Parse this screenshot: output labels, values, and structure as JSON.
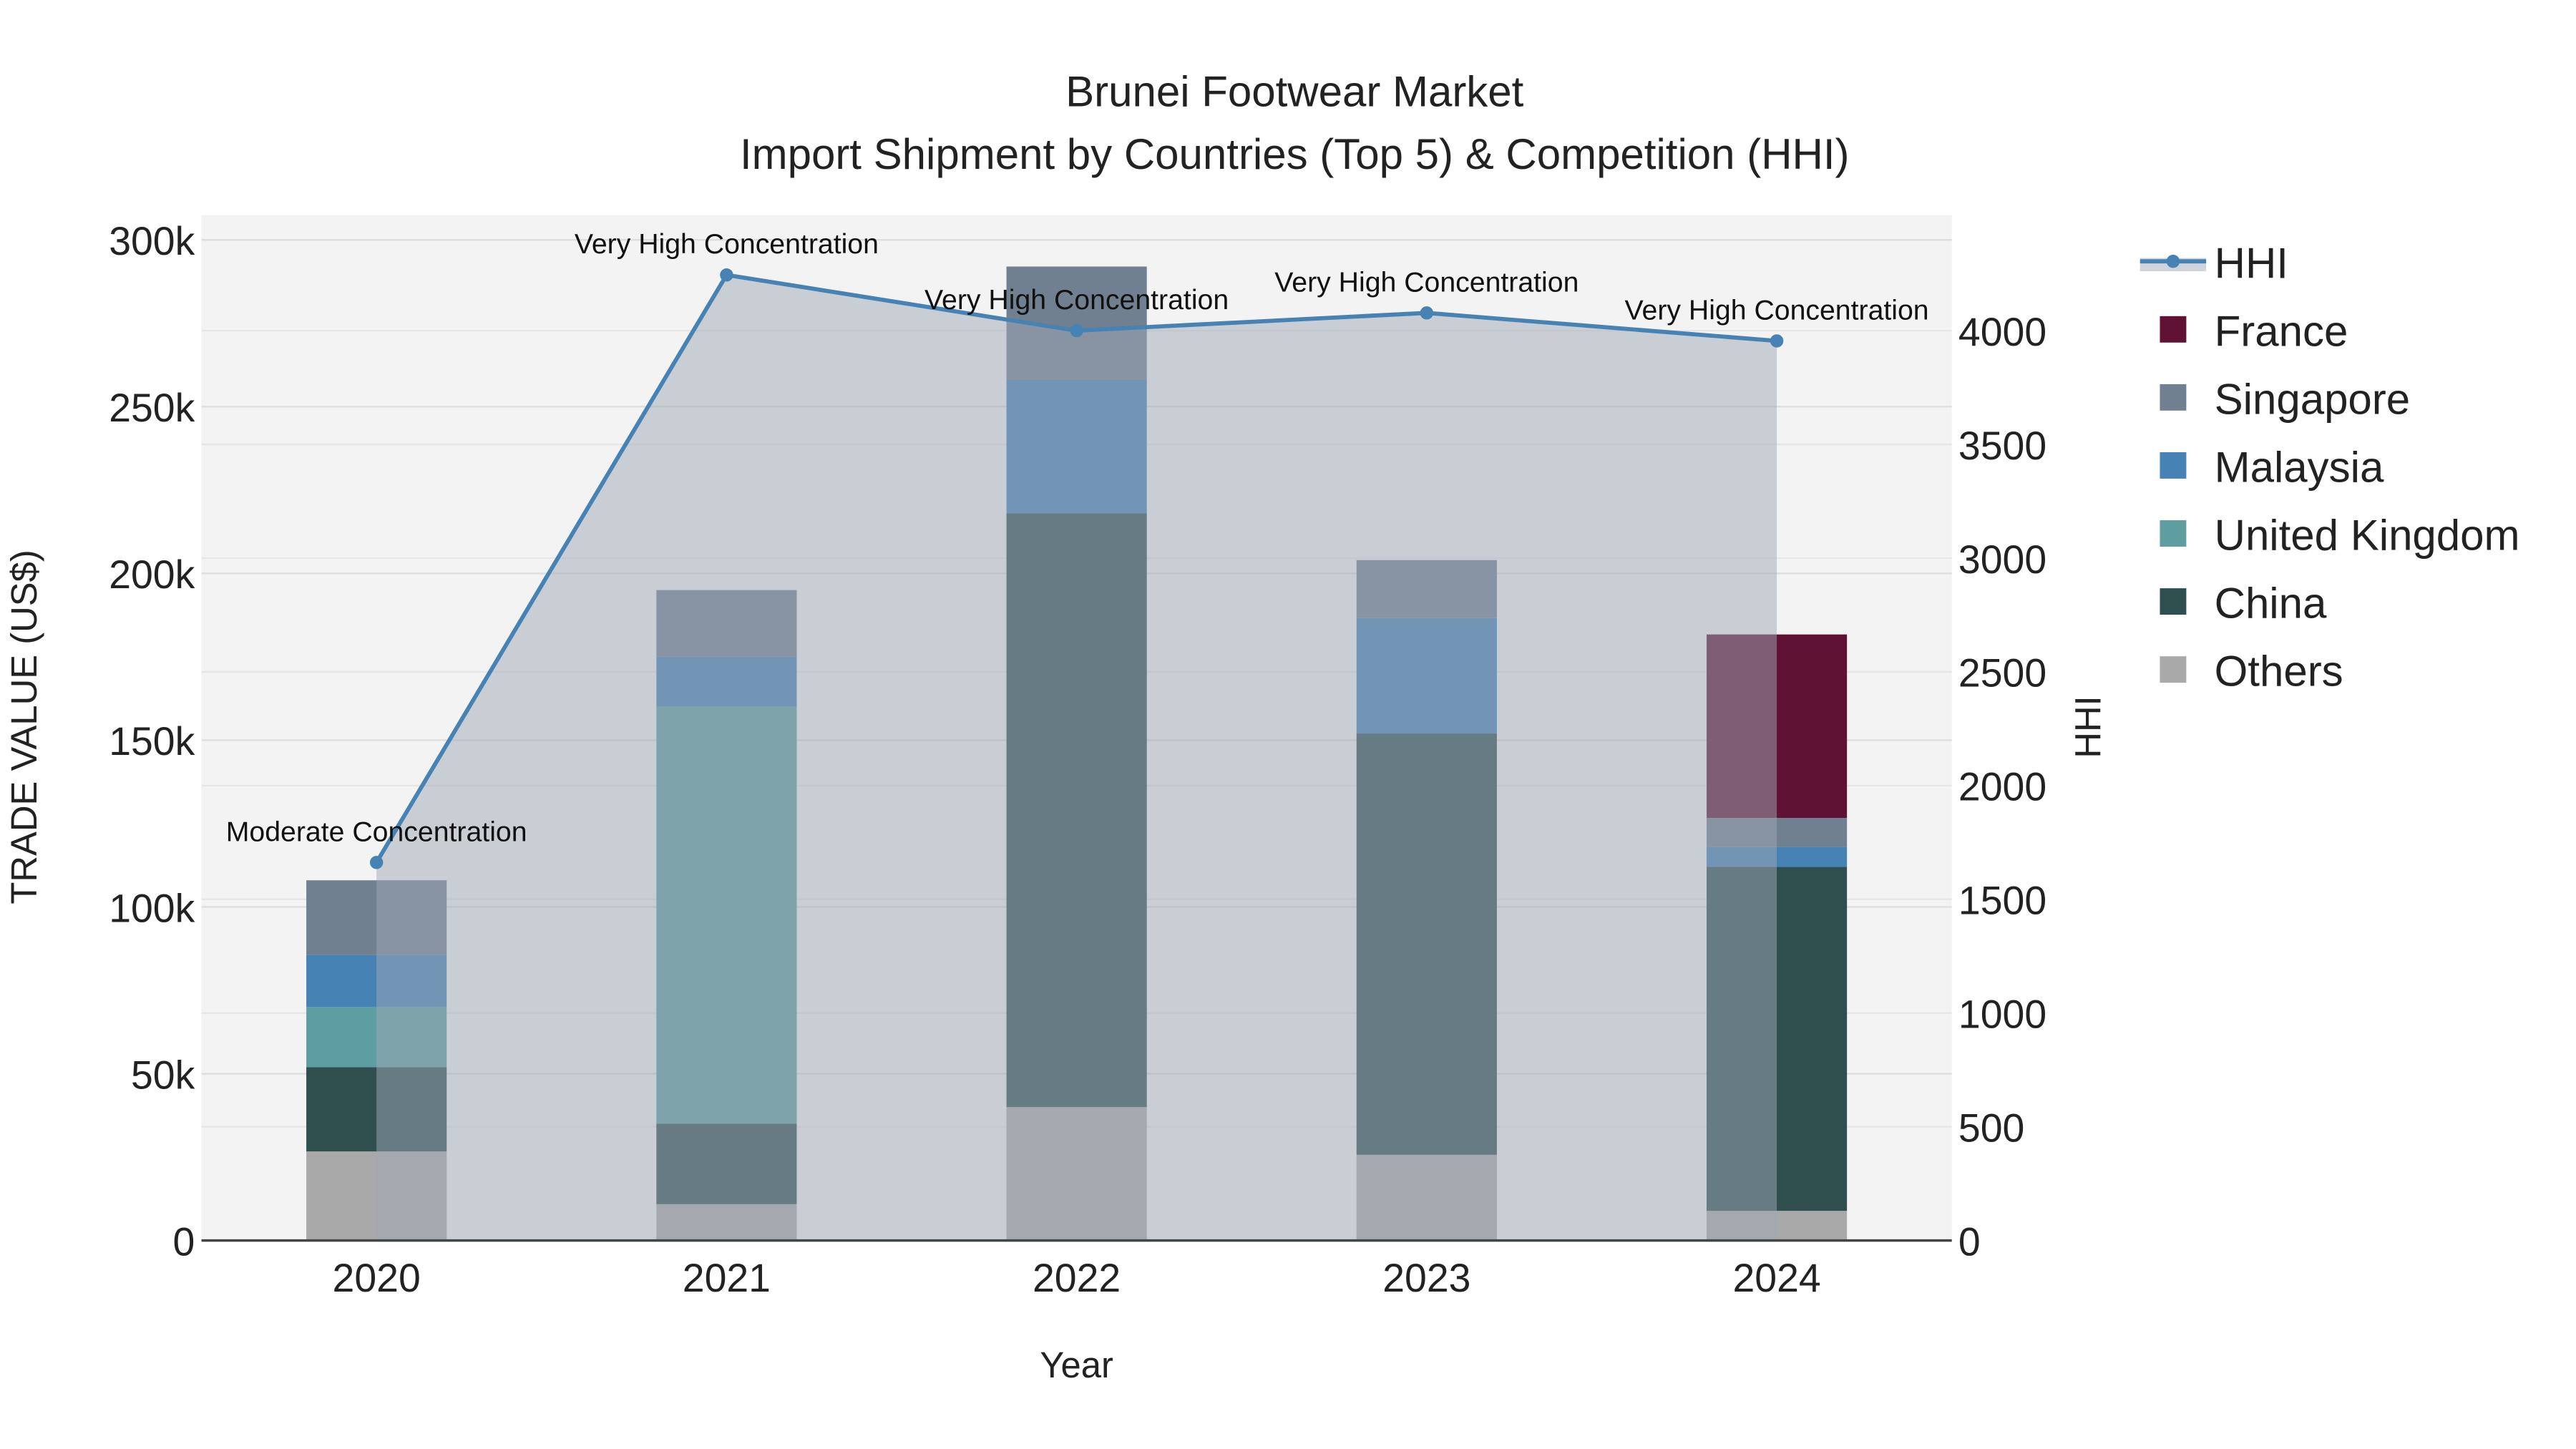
{
  "chart_data": {
    "type": "bar",
    "stacked": true,
    "title": "Brunei Footwear Market",
    "subtitle": "Import Shipment by Countries (Top 5) & Competition (HHI)",
    "xlabel": "Year",
    "ylabel": "TRADE VALUE (US$)",
    "y2label": "HHI",
    "categories": [
      "2020",
      "2021",
      "2022",
      "2023",
      "2024"
    ],
    "ylim": [
      0,
      300000
    ],
    "y2lim": [
      0,
      4400
    ],
    "yticks": [
      0,
      50000,
      100000,
      150000,
      200000,
      250000,
      300000
    ],
    "ytick_labels": [
      "0",
      "50k",
      "100k",
      "150k",
      "200k",
      "250k",
      "300k"
    ],
    "y2ticks": [
      0,
      500,
      1000,
      1500,
      2000,
      2500,
      3000,
      3500,
      4000
    ],
    "y2tick_labels": [
      "0",
      "500",
      "1000",
      "1500",
      "2000",
      "2500",
      "3000",
      "3500",
      "4000"
    ],
    "series": [
      {
        "name": "Others",
        "color": "#a9a9a9",
        "values": [
          26700,
          10900,
          40000,
          25700,
          8900
        ]
      },
      {
        "name": "China",
        "color": "#2f4f4f",
        "values": [
          25300,
          24100,
          178000,
          126300,
          103100
        ]
      },
      {
        "name": "United Kingdom",
        "color": "#5f9ea0",
        "values": [
          18000,
          125000,
          0,
          0,
          0
        ]
      },
      {
        "name": "Malaysia",
        "color": "#4682b4",
        "values": [
          15600,
          15000,
          40000,
          34600,
          6000
        ]
      },
      {
        "name": "Singapore",
        "color": "#708090",
        "values": [
          22400,
          20000,
          34000,
          17400,
          8700
        ]
      },
      {
        "name": "France",
        "color": "#5f1233",
        "values": [
          0,
          0,
          0,
          0,
          55000
        ]
      }
    ],
    "hhi": {
      "name": "HHI",
      "color": "#4682b4",
      "values": [
        1662,
        4245,
        4000,
        4078,
        3955
      ],
      "annotations": [
        "Moderate Concentration",
        "Very High Concentration",
        "Very High Concentration",
        "Very High Concentration",
        "Very High Concentration"
      ]
    },
    "legend": [
      "HHI",
      "France",
      "Singapore",
      "Malaysia",
      "United Kingdom",
      "China",
      "Others"
    ],
    "legend_position": "right",
    "grid": true
  }
}
